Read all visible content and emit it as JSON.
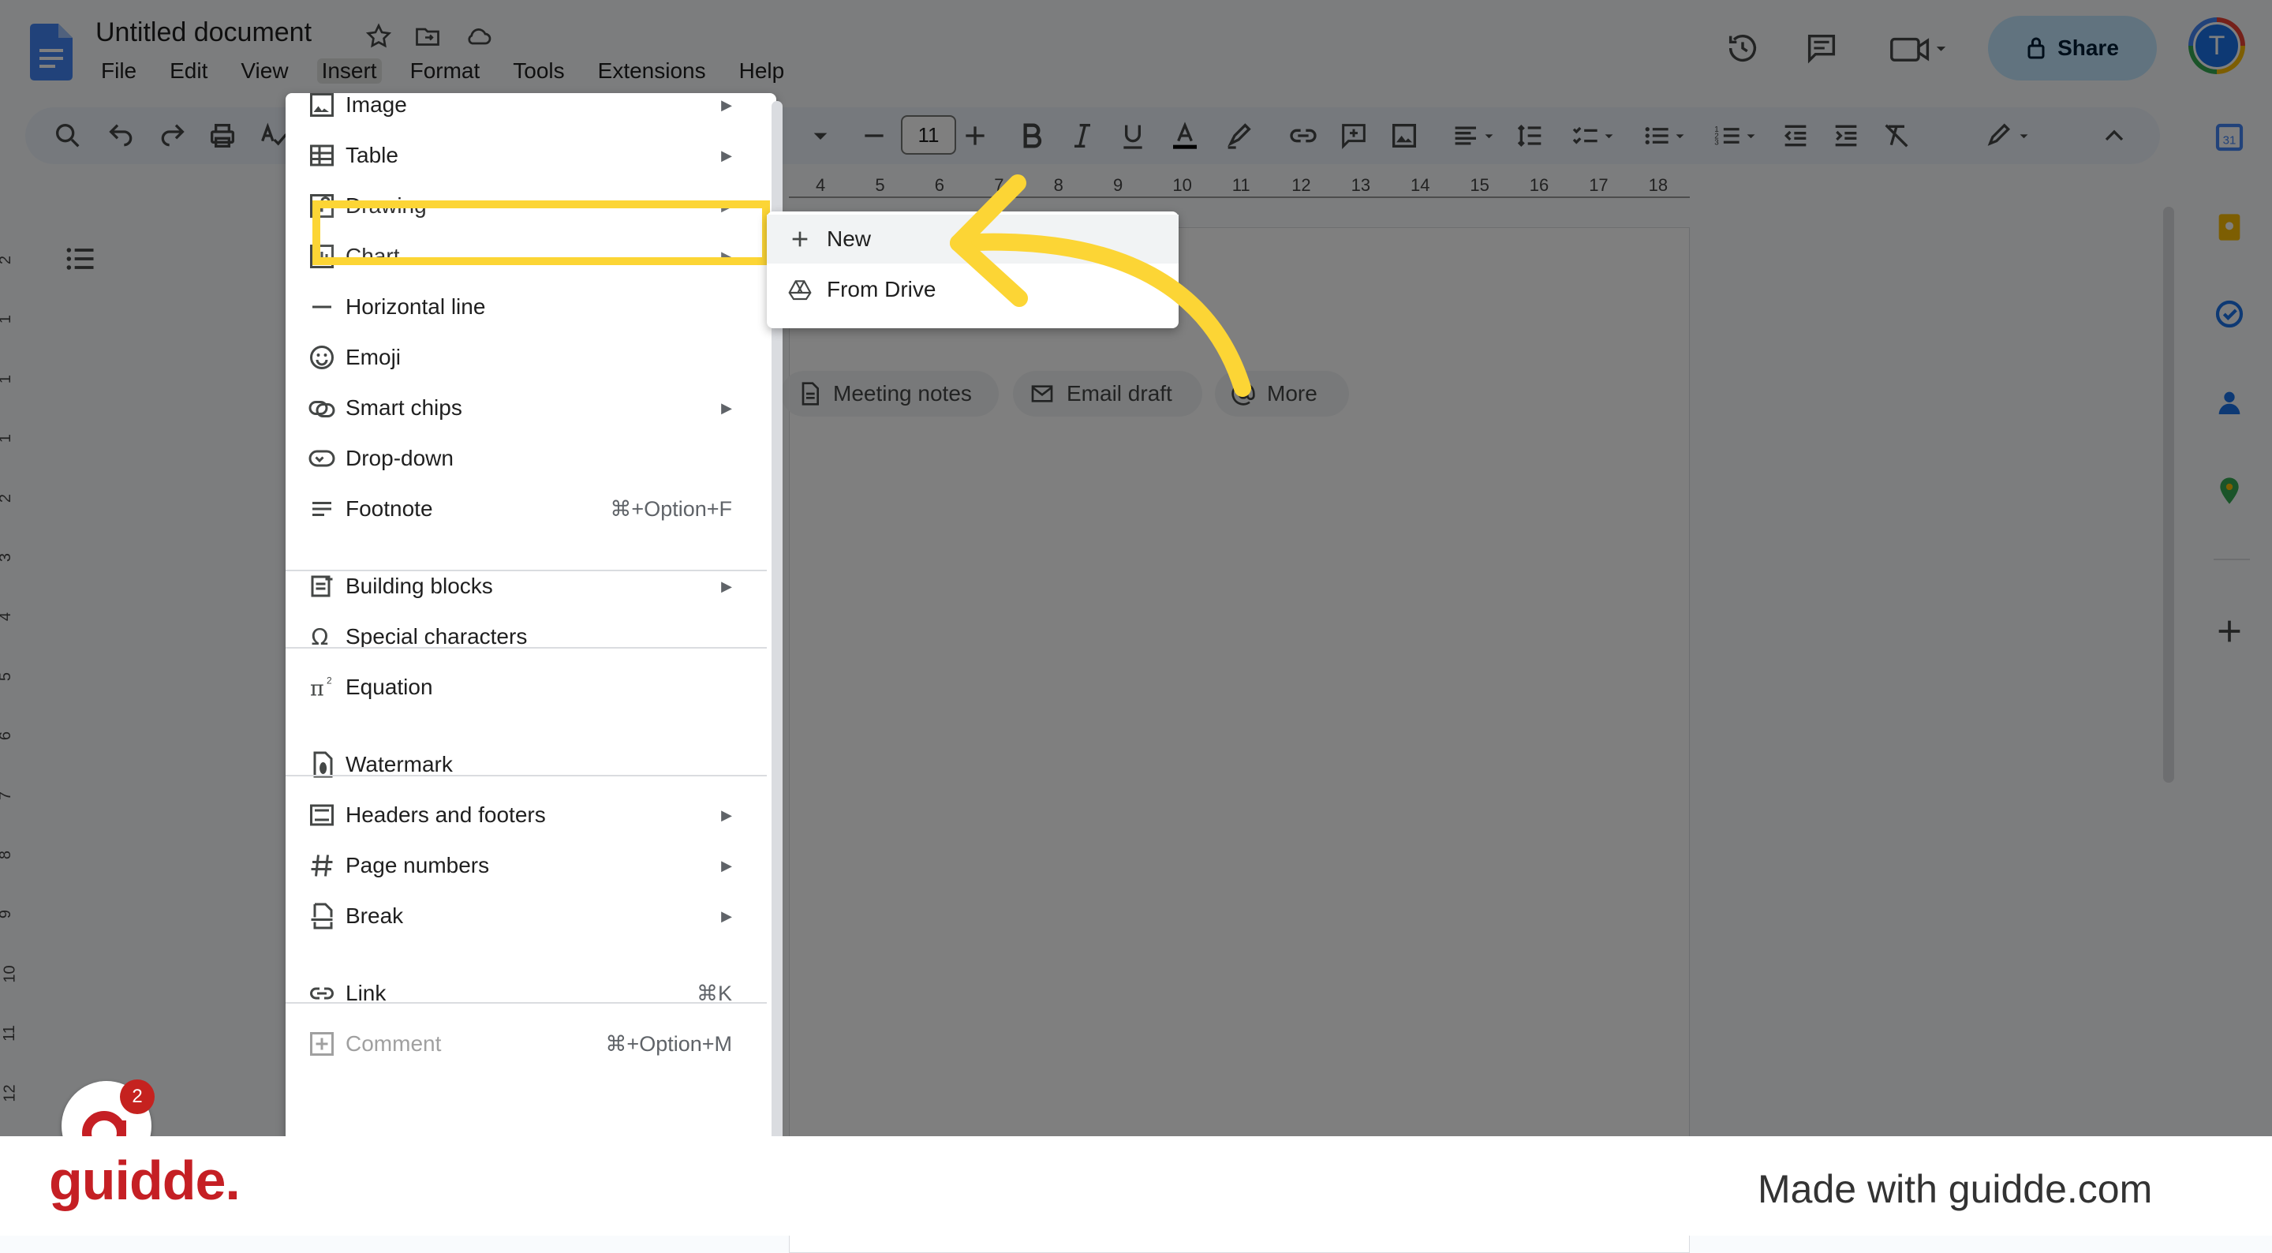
{
  "doc": {
    "title": "Untitled document",
    "menus": [
      "File",
      "Edit",
      "View",
      "Insert",
      "Format",
      "Tools",
      "Extensions",
      "Help"
    ],
    "active_menu": "Insert"
  },
  "header": {
    "share_label": "Share",
    "avatar_initial": "T"
  },
  "toolbar": {
    "font_size": "11"
  },
  "ruler": {
    "labels": [
      "4",
      "5",
      "6",
      "7",
      "8",
      "9",
      "10",
      "11",
      "12",
      "13",
      "14",
      "15",
      "16",
      "17",
      "18"
    ]
  },
  "vruler": {
    "labels": [
      "2",
      "1",
      "1",
      "1",
      "2",
      "3",
      "4",
      "5",
      "6",
      "7",
      "8",
      "9",
      "10",
      "11",
      "12"
    ]
  },
  "chips": [
    {
      "label": "Meeting notes",
      "icon": "document-icon"
    },
    {
      "label": "Email draft",
      "icon": "email-icon"
    },
    {
      "label": "More",
      "icon": "at-icon"
    }
  ],
  "insert_menu": {
    "items": [
      {
        "label": "Image",
        "icon": "image-icon",
        "submenu": true
      },
      {
        "label": "Table",
        "icon": "table-icon",
        "submenu": true
      },
      {
        "label": "Drawing",
        "icon": "drawing-icon",
        "submenu": true,
        "highlighted": true
      },
      {
        "label": "Chart",
        "icon": "chart-icon",
        "submenu": true
      },
      {
        "label": "Horizontal line",
        "icon": "horizontal-line-icon"
      },
      {
        "label": "Emoji",
        "icon": "emoji-icon"
      },
      {
        "label": "Smart chips",
        "icon": "smart-chips-icon",
        "submenu": true
      },
      {
        "label": "Drop-down",
        "icon": "dropdown-icon"
      },
      {
        "label": "Footnote",
        "icon": "footnote-icon",
        "shortcut": "⌘+Option+F"
      },
      {
        "label": "Building blocks",
        "icon": "building-blocks-icon",
        "submenu": true
      },
      {
        "label": "Special characters",
        "icon": "omega-icon"
      },
      {
        "label": "Equation",
        "icon": "pi-icon"
      },
      {
        "label": "Watermark",
        "icon": "watermark-icon"
      },
      {
        "label": "Headers and footers",
        "icon": "headers-footers-icon",
        "submenu": true
      },
      {
        "label": "Page numbers",
        "icon": "hash-icon",
        "submenu": true
      },
      {
        "label": "Break",
        "icon": "break-icon",
        "submenu": true
      },
      {
        "label": "Link",
        "icon": "link-icon",
        "shortcut": "⌘K"
      },
      {
        "label": "Comment",
        "icon": "comment-icon",
        "shortcut": "⌘+Option+M",
        "disabled": true
      }
    ]
  },
  "drawing_submenu": {
    "items": [
      {
        "label": "New",
        "icon": "plus-icon"
      },
      {
        "label": "From Drive",
        "icon": "drive-icon"
      }
    ]
  },
  "guidde": {
    "badge_count": "2"
  },
  "footer": {
    "logo": "guidde.",
    "text": "Made with guidde.com"
  },
  "colors": {
    "highlight": "#fcd535",
    "arrow": "#fcd535",
    "brand": "#c51f24",
    "share_bg": "#c2e7ff"
  }
}
